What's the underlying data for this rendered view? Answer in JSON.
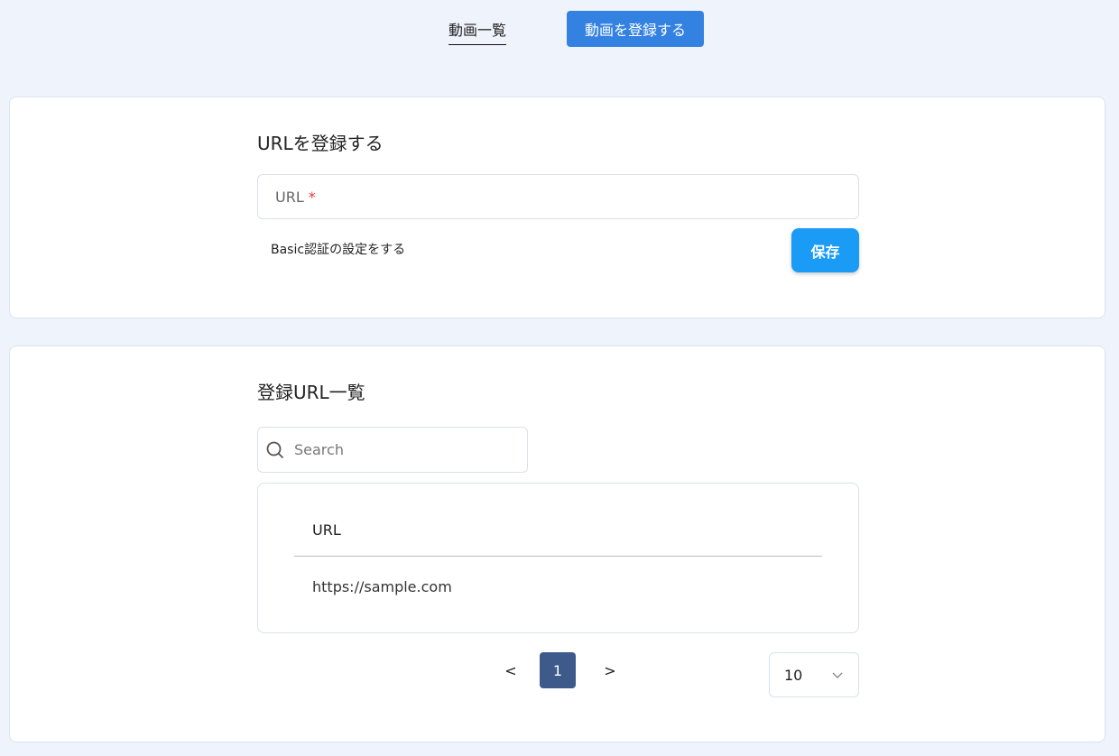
{
  "nav": {
    "list_label": "動画一覧",
    "register_label": "動画を登録する"
  },
  "register": {
    "title": "URLを登録する",
    "url_placeholder": "URL",
    "required_mark": "*",
    "basic_auth_label": "Basic認証の設定をする",
    "save_label": "保存"
  },
  "list": {
    "title": "登録URL一覧",
    "search_placeholder": "Search",
    "columns": [
      "URL"
    ],
    "rows": [
      [
        "https://sample.com"
      ]
    ]
  },
  "pagination": {
    "prev": "<",
    "current": "1",
    "next": ">",
    "page_size": "10"
  },
  "colors": {
    "accent": "#3381e0",
    "save": "#1a9bf5",
    "current_page": "#3d5a8a"
  }
}
